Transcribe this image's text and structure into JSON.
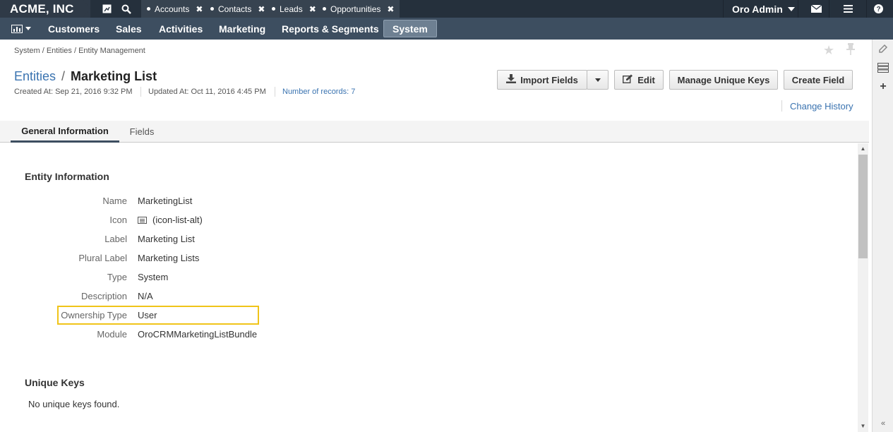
{
  "brand": "ACME, INC",
  "open_tabs": [
    {
      "label": "Accounts"
    },
    {
      "label": "Contacts"
    },
    {
      "label": "Leads"
    },
    {
      "label": "Opportunities"
    }
  ],
  "user": {
    "name": "Oro Admin"
  },
  "nav": {
    "items": [
      "Customers",
      "Sales",
      "Activities",
      "Marketing",
      "Reports & Segments",
      "System"
    ],
    "active": "System"
  },
  "breadcrumb": "System / Entities / Entity Management",
  "header": {
    "entities_link": "Entities",
    "separator": "/",
    "entity_name": "Marketing List",
    "created": "Created At: Sep 21, 2016 9:32 PM",
    "updated": "Updated At: Oct 11, 2016 4:45 PM",
    "records": "Number of records: 7"
  },
  "actions": {
    "import_fields": "Import Fields",
    "edit": "Edit",
    "manage_unique_keys": "Manage Unique Keys",
    "create_field": "Create Field",
    "change_history": "Change History"
  },
  "tabs": {
    "general": "General Information",
    "fields": "Fields"
  },
  "entity_info": {
    "title": "Entity Information",
    "rows": [
      {
        "label": "Name",
        "value": "MarketingList"
      },
      {
        "label": "Icon",
        "value": "(icon-list-alt)"
      },
      {
        "label": "Label",
        "value": "Marketing List"
      },
      {
        "label": "Plural Label",
        "value": "Marketing Lists"
      },
      {
        "label": "Type",
        "value": "System"
      },
      {
        "label": "Description",
        "value": "N/A"
      },
      {
        "label": "Ownership Type",
        "value": "User"
      },
      {
        "label": "Module",
        "value": "OroCRMMarketingListBundle"
      }
    ]
  },
  "unique_keys": {
    "title": "Unique Keys",
    "empty": "No unique keys found."
  },
  "colors": {
    "topbar": "#2f3a47",
    "navbar": "#3d4e60",
    "link": "#3a73b0",
    "highlight": "#f0c419"
  }
}
